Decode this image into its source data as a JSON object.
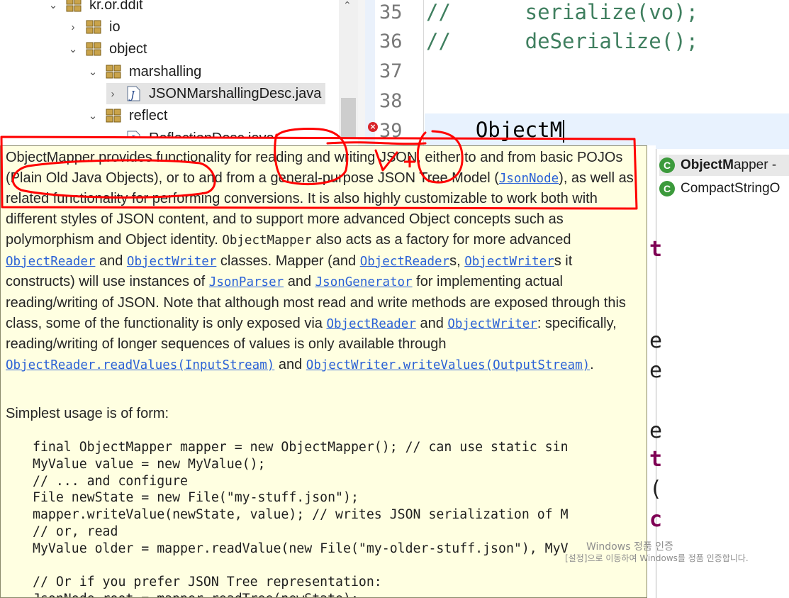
{
  "explorer": {
    "items": [
      {
        "label": "kr.or.ddit",
        "expanded": true
      },
      {
        "label": "io",
        "expanded": false
      },
      {
        "label": "object",
        "expanded": true
      },
      {
        "label": "marshalling",
        "expanded": true
      },
      {
        "label": "JSONMarshallingDesc.java",
        "expanded": false
      },
      {
        "label": "reflect",
        "expanded": true
      },
      {
        "label": "ReflectionDesc.java",
        "expanded": false
      }
    ]
  },
  "editor": {
    "lines": [
      {
        "num": "35",
        "code": "//      serialize(vo);"
      },
      {
        "num": "36",
        "code": "//      deSerialize();"
      },
      {
        "num": "37",
        "code": ""
      },
      {
        "num": "38",
        "code": ""
      },
      {
        "num": "39",
        "code": "    ObjectM"
      }
    ]
  },
  "javadoc": {
    "p1": [
      "ObjectMapper provides functionality for reading and writing JSON, either to and from basic POJOs (Plain Old Java Objects), or to and from a general-purpose JSON Tree Model (",
      "JsonNode",
      "), as well as related functionality for performing conversions. It is also highly customizable to work both with different styles of JSON content, and to support more advanced Object concepts such as polymorphism and Object identity. ",
      "ObjectMapper",
      " also acts as a factory for more advanced ",
      "ObjectReader",
      " and ",
      "ObjectWriter",
      " classes. Mapper (and ",
      "ObjectReader",
      "s, ",
      "ObjectWriter",
      "s it constructs) will use instances of ",
      "JsonParser",
      " and ",
      "JsonGenerator",
      " for implementing actual reading/writing of JSON. Note that although most read and write methods are exposed through this class, some of the functionality is only exposed via ",
      "ObjectReader",
      " and ",
      "ObjectWriter",
      ": specifically, reading/writing of longer sequences of values is only available through ",
      "ObjectReader.readValues(InputStream)",
      " and ",
      "ObjectWriter.writeValues(OutputStream)",
      "."
    ],
    "usage": "Simplest usage is of form:",
    "code": [
      "final ObjectMapper mapper = new ObjectMapper(); // can use static sin",
      "MyValue value = new MyValue();",
      "// ... and configure",
      "File newState = new File(\"my-stuff.json\");",
      "mapper.writeValue(newState, value); // writes JSON serialization of M",
      "// or, read",
      "MyValue older = mapper.readValue(new File(\"my-older-stuff.json\"), MyV",
      "",
      "// Or if you prefer JSON Tree representation:",
      "JsonNode root = mapper.readTree(newState);"
    ]
  },
  "proposals": [
    {
      "match": "ObjectM",
      "rest": "apper -"
    },
    {
      "match": "",
      "rest": "CompactStringO"
    }
  ],
  "watermark": {
    "title": "Windows 정품 인증",
    "body": "[설정]으로 이동하여 Windows를 정품 인증합니다."
  },
  "colors": {
    "doc_background": "#ffffe1",
    "link": "#2a61d6",
    "annotation": "#ff0000",
    "comment": "#3f7f5f"
  }
}
